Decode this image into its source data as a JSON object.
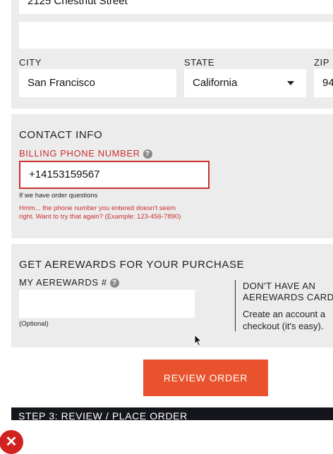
{
  "address": {
    "street_value": "2125 Chestnut Street",
    "street2_value": ""
  },
  "location": {
    "city_label": "CITY",
    "city_value": "San Francisco",
    "state_label": "STATE",
    "state_value": "California",
    "zip_label": "ZIP",
    "zip_value": "94"
  },
  "contact": {
    "title": "CONTACT INFO",
    "phone_label": "BILLING PHONE NUMBER",
    "help_glyph": "?",
    "phone_value": "+14153159567",
    "phone_hint": "If we have order questions",
    "error_line1": "Hmm... the phone number you entered doesn't seem",
    "error_line2": "right. Want to try that again? (Example: 123-456-7890)"
  },
  "rewards": {
    "title": "GET AEREWARDS FOR YOUR PURCHASE",
    "number_label": "MY AEREWARDS #",
    "help_glyph": "?",
    "number_value": "",
    "optional_note": "(Optional)",
    "side_title_line1": "DON'T HAVE AN",
    "side_title_line2": "AEREWARDS CARD",
    "side_text_line1": "Create an account a",
    "side_text_line2": "checkout (it's easy)."
  },
  "actions": {
    "review_order_label": "REVIEW ORDER"
  },
  "step3": {
    "title": "STEP 3: REVIEW / PLACE ORDER"
  },
  "overlay": {
    "close_glyph": "✕"
  },
  "colors": {
    "accent": "#e8532d",
    "error": "#c8302e",
    "panel": "#ececec",
    "dark_bar": "#14161c"
  }
}
